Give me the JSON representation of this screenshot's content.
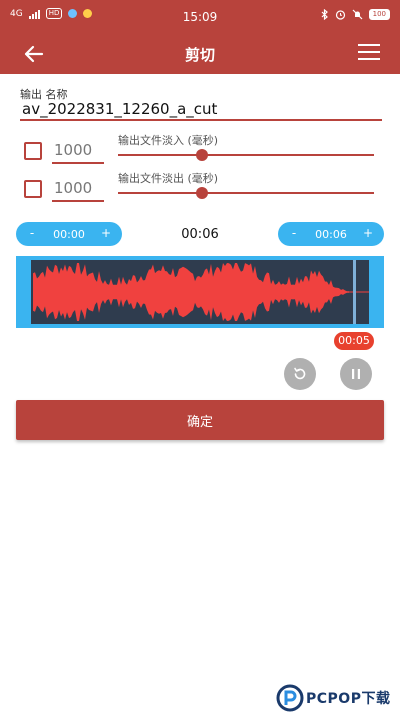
{
  "status_bar": {
    "network": "4G",
    "hd_badge": "HD",
    "time": "15:09",
    "battery": "100",
    "icons": [
      "bluetooth-icon",
      "alarm-icon",
      "silent-icon",
      "battery-icon"
    ]
  },
  "toolbar": {
    "title": "剪切",
    "back_icon": "arrow-left-icon",
    "menu_icon": "hamburger-menu-icon"
  },
  "output": {
    "label": "输出 名称",
    "value": "av_2022831_12260_a_cut"
  },
  "fade_in": {
    "checked": false,
    "value": "1000",
    "label": "输出文件淡入 (毫秒)",
    "slider_fraction": 0.33
  },
  "fade_out": {
    "checked": false,
    "value": "1000",
    "label": "输出文件淡出 (毫秒)",
    "slider_fraction": 0.33
  },
  "start_time": {
    "minus": "-",
    "value": "00:00",
    "plus": "+"
  },
  "duration": "00:06",
  "end_time": {
    "minus": "-",
    "value": "00:06",
    "plus": "+"
  },
  "waveform": {
    "background": "#3ab4f0",
    "wave_color": "#f0413f",
    "playhead_fraction": 0.955
  },
  "current_position": "00:05",
  "controls": {
    "reset_icon": "reset-icon",
    "pause_icon": "pause-icon"
  },
  "confirm_label": "确定",
  "watermark": "PCPOP下载",
  "colors": {
    "accent": "#b8433c",
    "timeline_blue": "#3ab4f0",
    "badge_red": "#e8412e"
  }
}
